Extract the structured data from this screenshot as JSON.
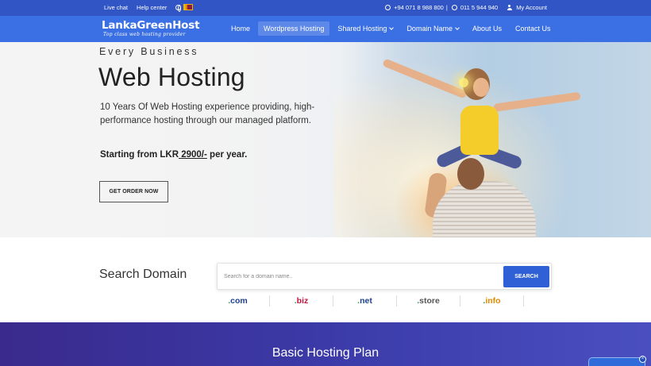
{
  "topbar": {
    "live_chat": "Live chat",
    "help_center": "Help center",
    "phone_1": "+94 071 8 988 800",
    "separator": "|",
    "phone_2": "011 5 944 940",
    "my_account": "My Account"
  },
  "nav": {
    "logo_name": "LankaGreenHost",
    "logo_tagline": "Top class web hosting provider",
    "items": [
      {
        "label": "Home",
        "dropdown": false
      },
      {
        "label": "Wordpress Hosting",
        "dropdown": false,
        "active": true
      },
      {
        "label": "Shared Hosting",
        "dropdown": true
      },
      {
        "label": "Domain Name",
        "dropdown": true
      },
      {
        "label": "About Us",
        "dropdown": false
      },
      {
        "label": "Contact Us",
        "dropdown": false
      }
    ]
  },
  "hero": {
    "eyebrow": "Every Business",
    "title": "Web Hosting",
    "description": "10 Years Of Web Hosting experience providing, high-performance hosting through our managed platform.",
    "price_prefix": "Starting from LKR",
    "price_amount": " 2900/-",
    "price_suffix": " per year.",
    "cta_label": "GET ORDER NOW"
  },
  "domain_search": {
    "label": "Search Domain",
    "placeholder": "Search for a domain name..",
    "button": "SEARCH",
    "tlds": [
      {
        "dot": ".",
        "ext": "com",
        "color": "#1f3f8f"
      },
      {
        "dot": ".",
        "ext": "biz",
        "color": "#c0143c"
      },
      {
        "dot": ".",
        "ext": "net",
        "color": "#1f3f8f"
      },
      {
        "dot": ".",
        "ext": "store",
        "color": "#555555"
      },
      {
        "dot": ".",
        "ext": "info",
        "color": "#e08a00"
      }
    ]
  },
  "plans": {
    "heading": "Basic Hosting Plan"
  },
  "colors": {
    "topbar": "#3155c4",
    "navbar": "#3b6fe4",
    "search_button": "#2f60d5",
    "plans_bg": "#3a2a8c"
  }
}
